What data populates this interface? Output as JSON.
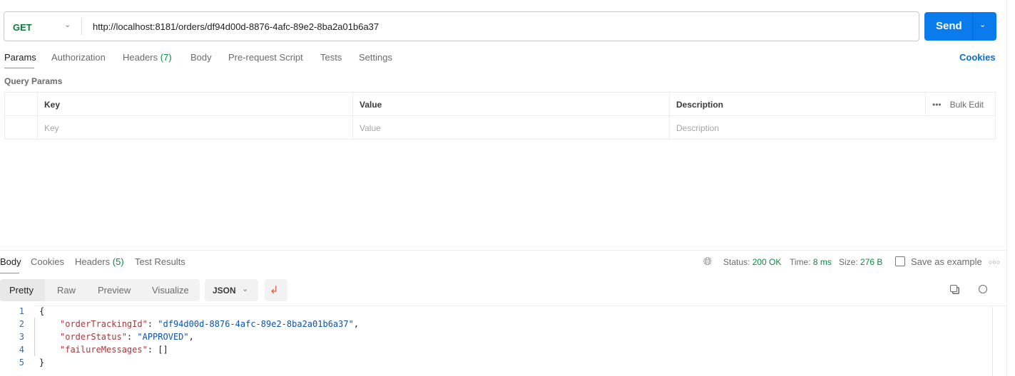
{
  "request": {
    "method": "GET",
    "url": "http://localhost:8181/orders/df94d00d-8876-4afc-89e2-8ba2a01b6a37",
    "send_label": "Send"
  },
  "request_tabs": [
    {
      "label": "Params"
    },
    {
      "label": "Authorization"
    },
    {
      "label": "Headers",
      "count": "(7)"
    },
    {
      "label": "Body"
    },
    {
      "label": "Pre-request Script"
    },
    {
      "label": "Tests"
    },
    {
      "label": "Settings"
    }
  ],
  "cookies_link": "Cookies",
  "query_params": {
    "title": "Query Params",
    "headers": [
      "Key",
      "Value",
      "Description"
    ],
    "bulk_edit": "Bulk Edit",
    "placeholders": [
      "Key",
      "Value",
      "Description"
    ]
  },
  "response_tabs": [
    {
      "label": "Body"
    },
    {
      "label": "Cookies"
    },
    {
      "label": "Headers",
      "count": "(5)"
    },
    {
      "label": "Test Results"
    }
  ],
  "status": {
    "status_label": "Status:",
    "status_value": "200 OK",
    "time_label": "Time:",
    "time_value": "8 ms",
    "size_label": "Size:",
    "size_value": "276 B",
    "save_label": "Save as example"
  },
  "view_modes": [
    "Pretty",
    "Raw",
    "Preview",
    "Visualize"
  ],
  "format": "JSON",
  "body_lines": [
    {
      "n": "1",
      "text": "{"
    },
    {
      "n": "2",
      "key": "\"orderTrackingId\"",
      "value": "\"df94d00d-8876-4afc-89e2-8ba2a01b6a37\"",
      "tail": ","
    },
    {
      "n": "3",
      "key": "\"orderStatus\"",
      "value": "\"APPROVED\"",
      "tail": ","
    },
    {
      "n": "4",
      "key": "\"failureMessages\"",
      "value": "[]",
      "tail": ""
    },
    {
      "n": "5",
      "text": "}"
    }
  ],
  "colors": {
    "accent": "#097bed",
    "tab_indicator": "#ff6c37",
    "success": "#0b8a45"
  }
}
